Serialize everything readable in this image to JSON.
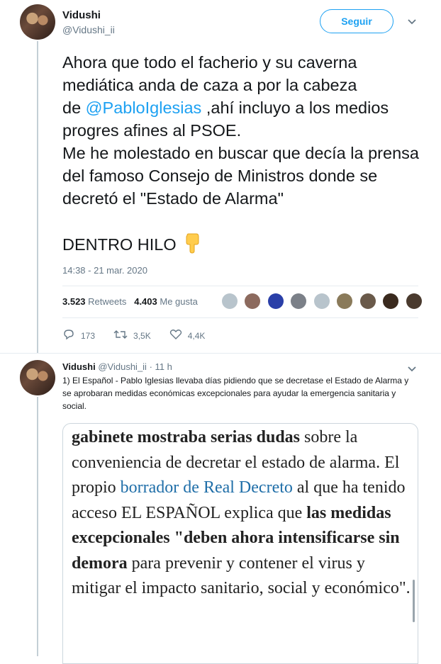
{
  "tweet": {
    "author_name": "Vidushi",
    "author_handle": "@Vidushi_ii",
    "follow_label": "Seguir",
    "text_lines": [
      "Ahora que todo el facherio y su caverna mediática anda de caza a por la cabeza",
      "de",
      "@PabloIglesias",
      " ,ahí incluyo a los medios progres afines al PSOE.",
      "Me he molestado en buscar que decía la prensa del famoso Consejo de Ministros donde se decretó el \"Estado de Alarma\"",
      "DENTRO HILO"
    ],
    "timestamp": "14:38 - 21 mar. 2020",
    "retweets_count": "3.523",
    "retweets_label": "Retweets",
    "likes_count": "4.403",
    "likes_label": "Me gusta",
    "reply_count": "173",
    "retweet_action_count": "3,5K",
    "like_action_count": "4,4K"
  },
  "reply": {
    "author_name": "Vidushi",
    "author_handle": "@Vidushi_ii",
    "time": "11 h",
    "dot": "·",
    "text": "1) El Español - Pablo Iglesias llevaba días pidiendo que se decretase el Estado de Alarma y se aprobaran medidas económicas excepcionales para ayudar la emergencia sanitaria y social."
  },
  "card": {
    "b1": "gabinete mostraba serias dudas",
    "t1": " sobre la conveniencia de decretar el estado de alarma. El propio ",
    "link": "borrador de Real Decreto",
    "t2": " al que ha tenido acceso EL ESPAÑOL explica que ",
    "b2": "las medidas excepcionales \"deben ahora intensificarse sin demora",
    "t3": " para prevenir y contener el virus y mitigar el impacto sanitario, social y económico\"."
  },
  "colors": {
    "accent": "#1da1f2",
    "muted": "#657786",
    "divider": "#e6ecf0"
  },
  "icons": [
    "reply-icon",
    "retweet-icon",
    "heart-icon",
    "chevron-down-icon",
    "pointing-down-emoji"
  ]
}
